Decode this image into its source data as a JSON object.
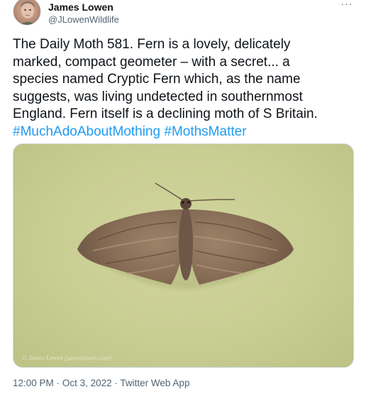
{
  "author": {
    "name": "James Lowen",
    "handle": "@JLowenWildlife"
  },
  "more_icon": "ellipsis-icon",
  "tweet": {
    "lines": [
      "The Daily Moth 581. Fern is a lovely, delicately",
      "marked, compact geometer – with a secret... a",
      "species named Cryptic Fern which, as the name",
      "suggests, was living undetected in southernmost",
      "England. Fern itself is a declining moth of S Britain."
    ],
    "hashtags": [
      "#MuchAdoAboutMothing",
      "#MothsMatter"
    ]
  },
  "photo": {
    "watermark": "© James Lowen (jameslowen.com)"
  },
  "meta": {
    "time": "12:00 PM",
    "separator": "·",
    "date": "Oct 3, 2022",
    "source": "Twitter Web App"
  },
  "colors": {
    "link": "#1d9bf0",
    "secondary_text": "#536471",
    "photo_background": "#c8cd92"
  }
}
